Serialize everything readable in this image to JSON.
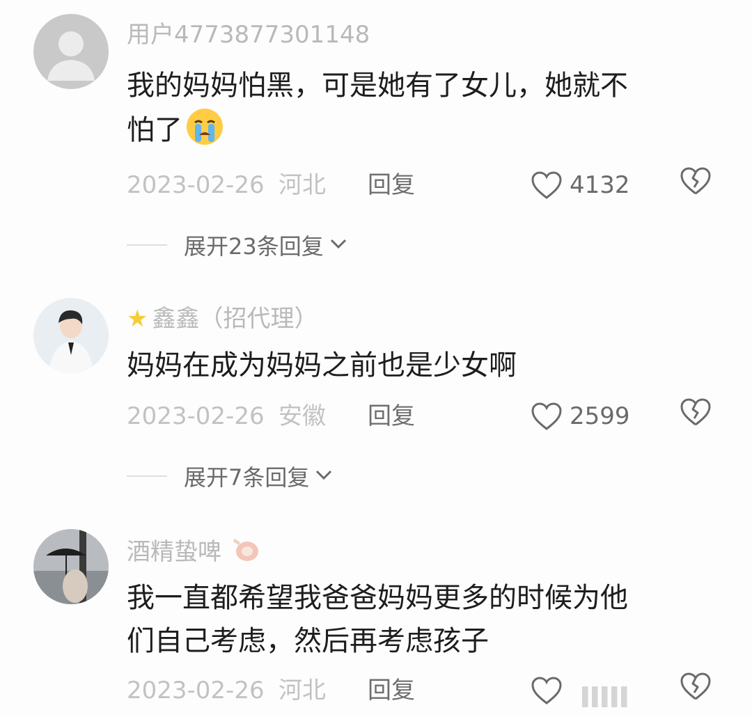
{
  "comments": [
    {
      "username": "用户4773877301148",
      "text_line1": "我的妈妈怕黑，可是她有了女儿，她就不",
      "text_line2": "怕了",
      "emoji": "crying-face-emoji",
      "date": "2023-02-26",
      "location": "河北",
      "reply_label": "回复",
      "likes": "4132",
      "expand_label": "展开23条回复"
    },
    {
      "username_prefix_icon": "star-icon",
      "username": "鑫鑫（招代理）",
      "text_line1": "妈妈在成为妈妈之前也是少女啊",
      "date": "2023-02-26",
      "location": "安徽",
      "reply_label": "回复",
      "likes": "2599",
      "expand_label": "展开7条回复"
    },
    {
      "username": "酒精蛰啤",
      "username_suffix_icon": "ham-emoji",
      "text_line1": "我一直都希望我爸爸妈妈更多的时候为他",
      "text_line2": "们自己考虑，然后再考虑孩子",
      "date": "2023-02-26",
      "location": "河北",
      "reply_label": "回复"
    }
  ],
  "colors": {
    "text": "#1d1d1d",
    "meta": "#c2c2c2",
    "username": "#b9b9b9",
    "action": "#6a6a6a"
  }
}
